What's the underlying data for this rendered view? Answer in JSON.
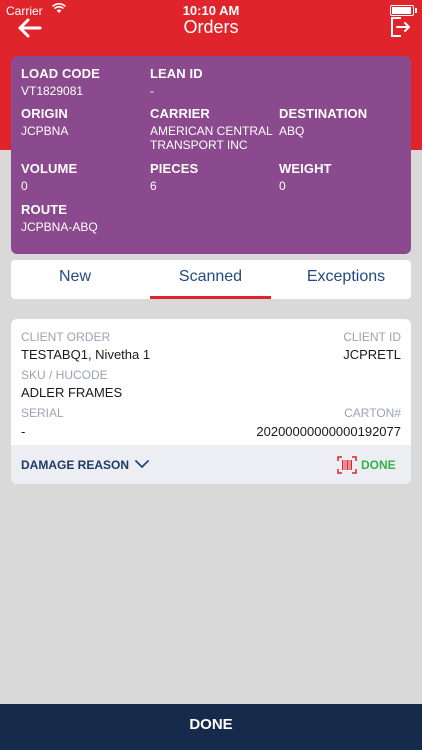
{
  "status_bar": {
    "carrier": "Carrier",
    "time": "10:10 AM"
  },
  "nav": {
    "title": "Orders",
    "back_icon": "back-arrow-icon",
    "logout_icon": "logout-icon"
  },
  "load_summary": {
    "load_code": {
      "label": "LOAD CODE",
      "value": "VT1829081"
    },
    "lean_id": {
      "label": "LEAN ID",
      "value": "-"
    },
    "origin": {
      "label": "ORIGIN",
      "value": "JCPBNA"
    },
    "carrier": {
      "label": "CARRIER",
      "value": "AMERICAN CENTRAL TRANSPORT INC"
    },
    "destination": {
      "label": "DESTINATION",
      "value": "ABQ"
    },
    "volume": {
      "label": "VOLUME",
      "value": "0"
    },
    "pieces": {
      "label": "PIECES",
      "value": "6"
    },
    "weight": {
      "label": "WEIGHT",
      "value": "0"
    },
    "route": {
      "label": "ROUTE",
      "value": "JCPBNA-ABQ"
    }
  },
  "tabs": [
    {
      "label": "New",
      "active": false
    },
    {
      "label": "Scanned",
      "active": true
    },
    {
      "label": "Exceptions",
      "active": false
    }
  ],
  "order_card": {
    "client_order_label": "CLIENT ORDER",
    "client_order_value": "TESTABQ1, Nivetha 1",
    "client_id_label": "CLIENT ID",
    "client_id_value": "JCPRETL",
    "sku_label": "SKU / HUCODE",
    "sku_value": "ADLER FRAMES",
    "serial_label": "SERIAL",
    "serial_value": "-",
    "carton_label": "CARTON#",
    "carton_value": "20200000000000192077",
    "damage_reason_label": "DAMAGE REASON",
    "scan_status_label": "DONE"
  },
  "footer": {
    "done_label": "DONE"
  },
  "colors": {
    "header": "#e0242b",
    "summary": "#8b4a8e",
    "footer": "#162a4c",
    "done_green": "#34b24a",
    "link_blue": "#234a82"
  }
}
